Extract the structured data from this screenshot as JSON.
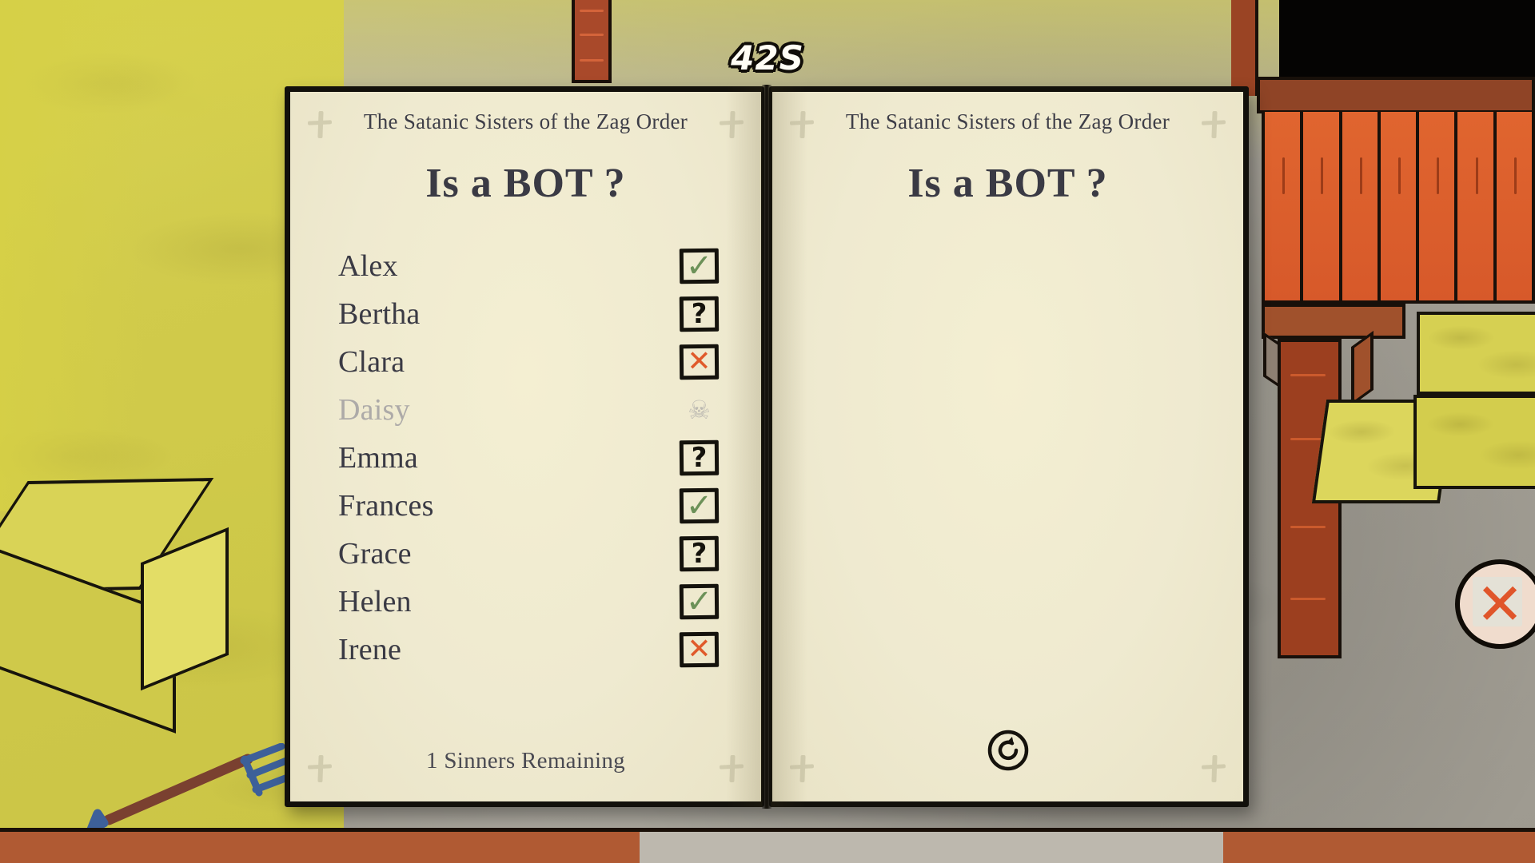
{
  "hud": {
    "timer": "42S"
  },
  "book": {
    "left_page": {
      "title": "The Satanic Sisters of the Zag Order",
      "heading": "Is a BOT ?",
      "rows": [
        {
          "name": "Alex",
          "state": "check",
          "glyph": "✓",
          "dead": false
        },
        {
          "name": "Bertha",
          "state": "unknown",
          "glyph": "?",
          "dead": false
        },
        {
          "name": "Clara",
          "state": "cross",
          "glyph": "✕",
          "dead": false
        },
        {
          "name": "Daisy",
          "state": "skull",
          "glyph": "☠",
          "dead": true
        },
        {
          "name": "Emma",
          "state": "unknown",
          "glyph": "?",
          "dead": false
        },
        {
          "name": "Frances",
          "state": "check",
          "glyph": "✓",
          "dead": false
        },
        {
          "name": "Grace",
          "state": "unknown",
          "glyph": "?",
          "dead": false
        },
        {
          "name": "Helen",
          "state": "check",
          "glyph": "✓",
          "dead": false
        },
        {
          "name": "Irene",
          "state": "cross",
          "glyph": "✕",
          "dead": false
        }
      ],
      "footer": "1 Sinners Remaining"
    },
    "right_page": {
      "title": "The Satanic Sisters of the Zag Order",
      "heading": "Is a BOT ?",
      "refresh_icon": "refresh-icon"
    }
  },
  "controls": {
    "close_label": "✕",
    "close_icon": "close-x-icon"
  },
  "colors": {
    "paper": "#f2edcd",
    "ink": "#3a3a44",
    "check_green": "#6c9158",
    "cross_red": "#e05a2b",
    "dead_grey": "#adaaa8",
    "barn_wall": "#dd5f2c",
    "hay": "#d6d052",
    "beam_brown": "#9a4424"
  },
  "icons": {
    "corner_cross": "cross-dagger-icon",
    "skull": "skull-and-crossbones-icon",
    "check": "checkmark-icon",
    "question": "question-mark-icon",
    "x": "x-mark-icon"
  }
}
